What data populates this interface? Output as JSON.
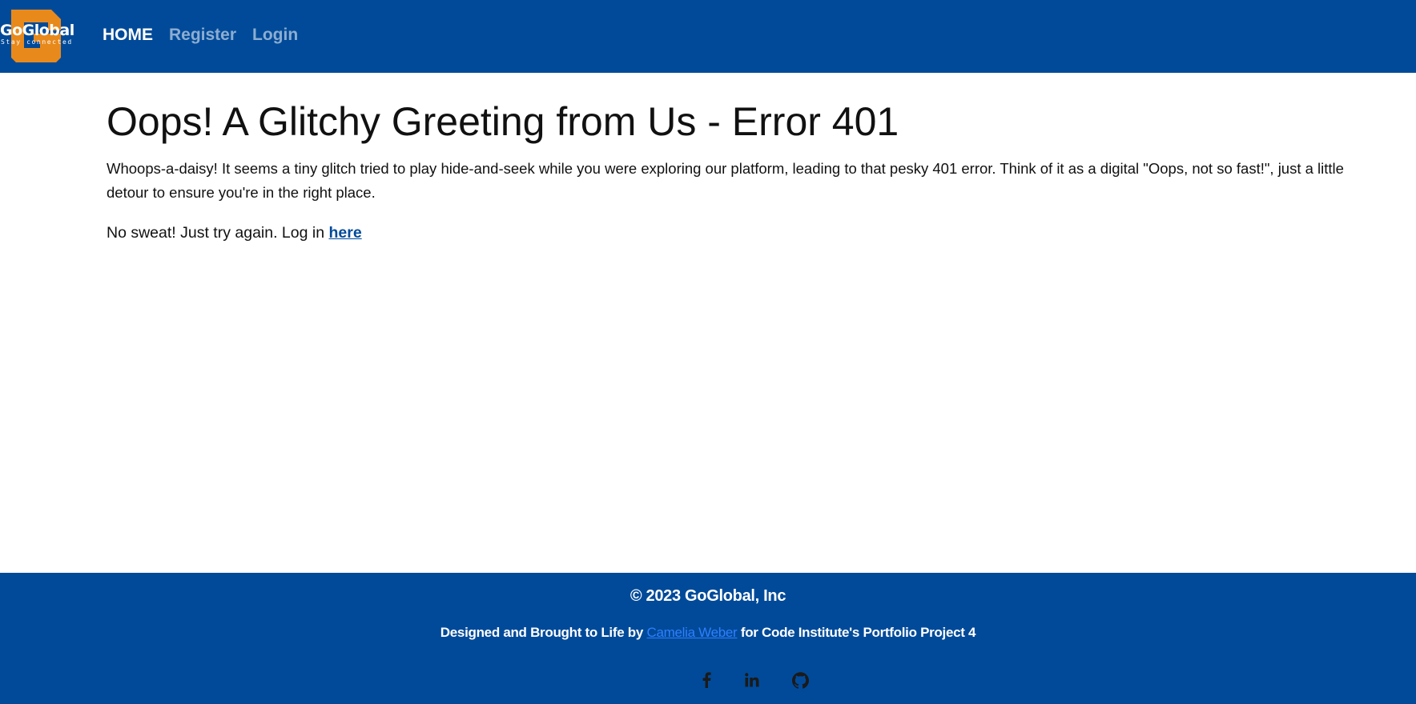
{
  "brand": {
    "name": "GoGlobal",
    "tagline": "Stay connected",
    "logo_accent_color": "#e8891c"
  },
  "nav": {
    "items": [
      {
        "label": "HOME",
        "state": "active"
      },
      {
        "label": "Register",
        "state": "inactive"
      },
      {
        "label": "Login",
        "state": "inactive"
      }
    ]
  },
  "main": {
    "title": "Oops! A Glitchy Greeting from Us - Error 401",
    "lead": "Whoops-a-daisy! It seems a tiny glitch tried to play hide-and-seek while you were exploring our platform, leading to that pesky 401 error. Think of it as a digital \"Oops, not so fast!\", just a little detour to ensure you're in the right place.",
    "retry_prefix": "No sweat! Just try again. Log in ",
    "retry_link": "here"
  },
  "footer": {
    "copyright": "© 2023 GoGlobal, Inc",
    "credits_prefix": "Designed and Brought to Life by ",
    "credits_author": "Camelia Weber",
    "credits_suffix": " for Code Institute's Portfolio Project 4",
    "social": [
      {
        "icon": "facebook-icon"
      },
      {
        "icon": "linkedin-icon"
      },
      {
        "icon": "github-icon"
      }
    ]
  },
  "colors": {
    "header_footer_bg": "#004a99",
    "link_blue": "#2f7fff",
    "body_text": "#111111"
  }
}
